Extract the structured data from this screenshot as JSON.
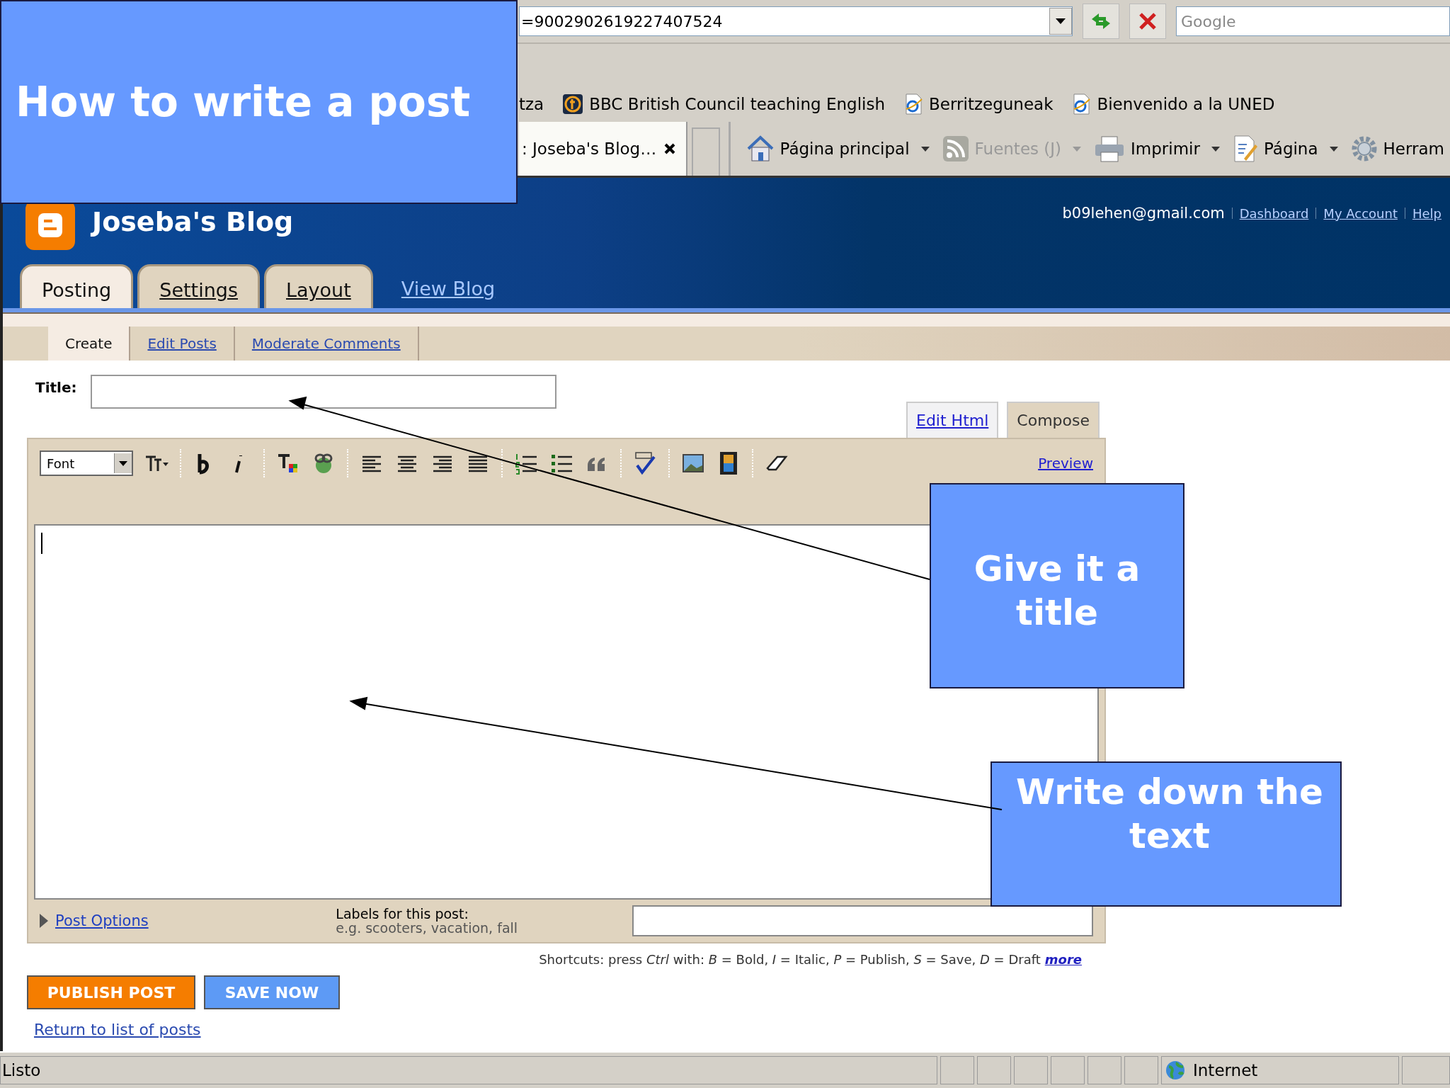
{
  "slide_title": "How to write a post",
  "browser": {
    "address": "=9002902619227407524",
    "search_placeholder": "Google",
    "favorites": [
      {
        "label": "tza",
        "kind": "none"
      },
      {
        "label": "BBC  British Council teaching English",
        "kind": "site"
      },
      {
        "label": "Berritzeguneak",
        "kind": "page"
      },
      {
        "label": "Bienvenido a la UNED",
        "kind": "page"
      }
    ],
    "tabs": [
      {
        "label": ": Joseba's Blog…",
        "selected": true
      }
    ],
    "commands": [
      {
        "label": "Página principal",
        "kind": "home",
        "disabled": false,
        "menu": true
      },
      {
        "label": "Fuentes (J)",
        "kind": "feed",
        "disabled": true,
        "menu": true
      },
      {
        "label": "Imprimir",
        "kind": "print",
        "disabled": false,
        "menu": true
      },
      {
        "label": "Página",
        "kind": "page",
        "disabled": false,
        "menu": true
      },
      {
        "label": "Herram",
        "kind": "tools",
        "disabled": false,
        "menu": false
      }
    ],
    "status_bar": {
      "text": "Listo",
      "zone": "Internet"
    }
  },
  "blog": {
    "title": "Joseba's Blog",
    "account": "b09lehen@gmail.com",
    "account_links": [
      "Dashboard",
      "My Account",
      "Help"
    ],
    "tabs": [
      {
        "label": "Posting",
        "selected": true
      },
      {
        "label": "Settings",
        "selected": false
      },
      {
        "label": "Layout",
        "selected": false
      }
    ],
    "view_blog": "View Blog",
    "subtabs": [
      {
        "label": "Create",
        "selected": true
      },
      {
        "label": "Edit Posts",
        "selected": false
      },
      {
        "label": "Moderate Comments",
        "selected": false
      }
    ],
    "title_label": "Title:",
    "editor_modes": [
      {
        "label": "Edit Html",
        "selected": false
      },
      {
        "label": "Compose",
        "selected": true
      }
    ],
    "font_select": "Font",
    "preview": "Preview",
    "post_options": "Post Options",
    "labels_title": "Labels for this post:",
    "labels_hint": "e.g. scooters, vacation, fall",
    "shortcuts": "Shortcuts: press *Ctrl* with: *B* = Bold, *I* = Italic, *P* = Publish, *S* = Save, *D* = Draft",
    "shortcuts_more": "more",
    "buttons": [
      {
        "label": "PUBLISH POST",
        "kind": "primary"
      },
      {
        "label": "SAVE NOW",
        "kind": "secondary"
      }
    ],
    "return_link": "Return to list of posts"
  },
  "callouts": [
    {
      "text": "Give it a title"
    },
    {
      "text": "Write down the text"
    }
  ]
}
